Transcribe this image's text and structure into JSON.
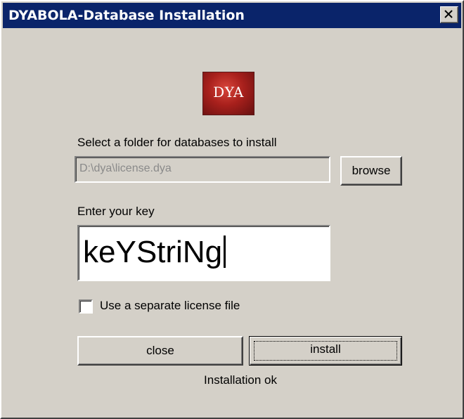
{
  "window": {
    "title": "DYABOLA-Database Installation"
  },
  "logo": {
    "text": "DYA"
  },
  "folder": {
    "label": "Select a folder for databases to install",
    "value": "D:\\dya\\license.dya",
    "browse_label": "browse"
  },
  "key": {
    "label": "Enter your key",
    "value": "keYStriNg"
  },
  "license_option": {
    "label": "Use a separate license file",
    "checked": false
  },
  "actions": {
    "close_label": "close",
    "install_label": "install"
  },
  "status": {
    "text": "Installation ok"
  },
  "colors": {
    "titlebar": "#0a246a",
    "window_face": "#d4d0c8",
    "logo_red": "#a8201c"
  },
  "icons": {
    "window_close": "close-icon"
  }
}
